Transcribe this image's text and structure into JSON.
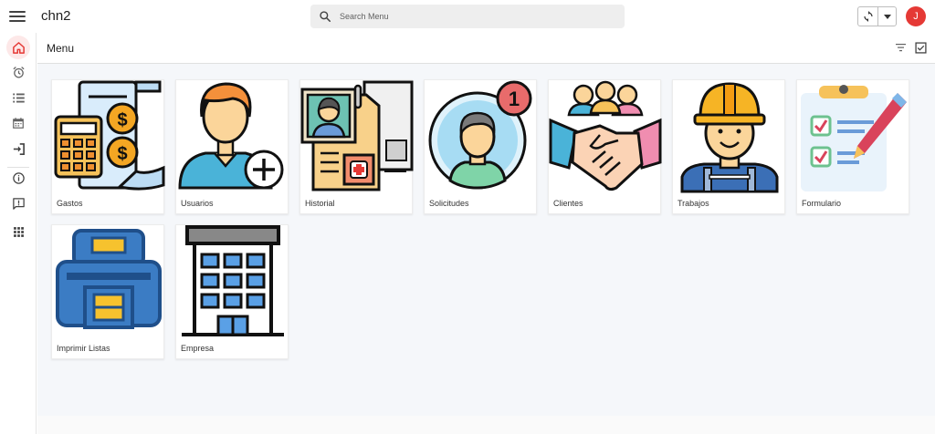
{
  "app": {
    "title": "chn2"
  },
  "search": {
    "placeholder": "Search Menu"
  },
  "user": {
    "initial": "J",
    "avatar_color": "#e53935"
  },
  "page": {
    "title": "Menu"
  },
  "sidebar": {
    "items": [
      {
        "icon": "home-icon",
        "active": true
      },
      {
        "icon": "alarm-icon"
      },
      {
        "icon": "list-icon"
      },
      {
        "icon": "calendar-icon"
      },
      {
        "icon": "login-icon"
      },
      {
        "icon": "info-icon"
      },
      {
        "icon": "feedback-icon"
      },
      {
        "icon": "apps-grid-icon"
      }
    ]
  },
  "tiles": [
    {
      "label": "Gastos",
      "icon": "calculator-coins-icon"
    },
    {
      "label": "Usuarios",
      "icon": "add-user-icon"
    },
    {
      "label": "Historial",
      "icon": "medical-record-icon"
    },
    {
      "label": "Solicitudes",
      "icon": "notification-user-icon",
      "badge": "1"
    },
    {
      "label": "Clientes",
      "icon": "handshake-icon"
    },
    {
      "label": "Trabajos",
      "icon": "worker-icon"
    },
    {
      "label": "Formulario",
      "icon": "clipboard-checklist-icon"
    },
    {
      "label": "Imprimir Listas",
      "icon": "printer-icon"
    },
    {
      "label": "Empresa",
      "icon": "building-icon"
    }
  ],
  "colors": {
    "accent": "#e53935",
    "background": "#f5f7fa"
  }
}
